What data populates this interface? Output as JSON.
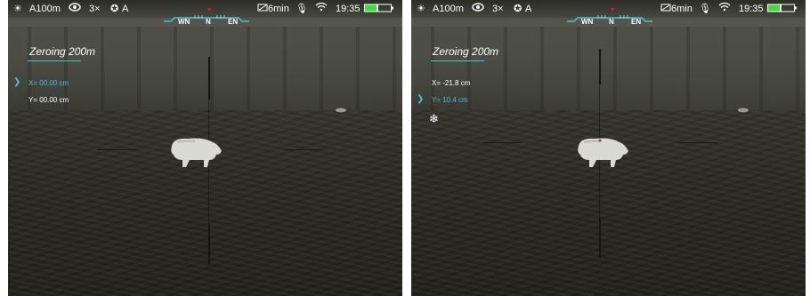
{
  "panels": [
    {
      "status": {
        "range": "A100m",
        "zoom": "3×",
        "calibration": "A",
        "record_time": "6min",
        "time": "19:35",
        "icons": [
          "brightness-icon",
          "eye-icon",
          "calibration-icon",
          "video-icon",
          "microphone-icon",
          "wifi-icon",
          "battery-icon"
        ],
        "compass": {
          "left": "WN",
          "center": "N",
          "right": "EN"
        }
      },
      "zeroing": {
        "title": "Zeroing 200m",
        "x_label": "X= 00.00 cm",
        "y_label": "Y= 00.00 cm",
        "selected": "x"
      },
      "freeze_icon": false
    },
    {
      "status": {
        "range": "A100m",
        "zoom": "3×",
        "calibration": "A",
        "record_time": "6min",
        "time": "19:35",
        "icons": [
          "brightness-icon",
          "eye-icon",
          "calibration-icon",
          "video-icon",
          "microphone-icon",
          "wifi-icon",
          "battery-icon"
        ],
        "compass": {
          "left": "WN",
          "center": "N",
          "right": "EN"
        }
      },
      "zeroing": {
        "title": "Zeroing 200m",
        "x_label": "X= -21.8 cm",
        "y_label": "Y= 10.4 cm",
        "selected": "y"
      },
      "freeze_icon": true
    }
  ],
  "colors": {
    "accent": "#49c3d8",
    "battery": "#3ddc3d",
    "compass_marker": "#e0202a"
  }
}
